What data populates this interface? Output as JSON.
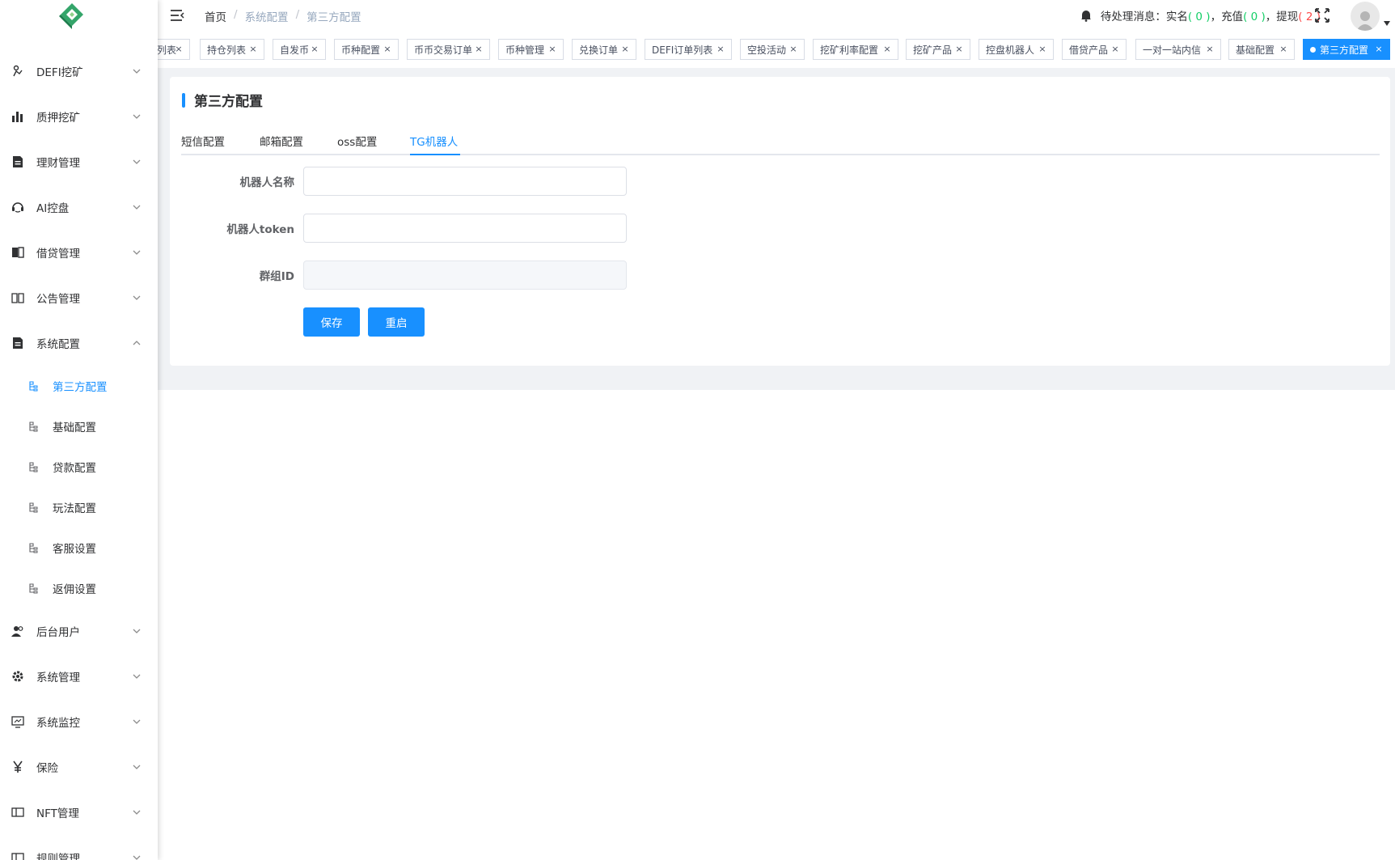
{
  "colors": {
    "primary": "#1890ff",
    "green": "#13ce66",
    "red": "#ff4949",
    "sidebar_bg": "#ffffff"
  },
  "sidebar": {
    "logo": "logo-icon",
    "menu": [
      {
        "label": "DEFI挖矿",
        "icon": "defi-icon"
      },
      {
        "label": "质押挖矿",
        "icon": "bar-chart-icon"
      },
      {
        "label": "理财管理",
        "icon": "document-icon"
      },
      {
        "label": "AI控盘",
        "icon": "robot-icon"
      },
      {
        "label": "借贷管理",
        "icon": "book-icon"
      },
      {
        "label": "公告管理",
        "icon": "open-book-icon"
      },
      {
        "label": "系统配置",
        "icon": "document-icon",
        "expanded": true
      },
      {
        "label": "后台用户",
        "icon": "users-icon"
      },
      {
        "label": "系统管理",
        "icon": "gear-icon"
      },
      {
        "label": "系统监控",
        "icon": "monitor-icon"
      },
      {
        "label": "保险",
        "icon": "yen-icon"
      },
      {
        "label": "NFT管理",
        "icon": "panel-icon"
      },
      {
        "label": "规则管理",
        "icon": "panel-icon"
      }
    ],
    "submenu": [
      {
        "label": "第三方配置",
        "active": true
      },
      {
        "label": "基础配置"
      },
      {
        "label": "贷款配置"
      },
      {
        "label": "玩法配置"
      },
      {
        "label": "客服设置"
      },
      {
        "label": "返佣设置"
      }
    ]
  },
  "navbar": {
    "breadcrumb": [
      "首页",
      "系统配置",
      "第三方配置"
    ],
    "breadcrumb_sep": "/",
    "notice": {
      "prefix": "待处理消息：",
      "items": [
        {
          "label": "实名",
          "count": "0",
          "color": "green"
        },
        {
          "label": "充值",
          "count": "0",
          "color": "green"
        },
        {
          "label": "提现",
          "count": "2",
          "color": "red"
        }
      ]
    }
  },
  "tags": [
    {
      "label": "列表"
    },
    {
      "label": "持仓列表"
    },
    {
      "label": "自发币"
    },
    {
      "label": "币种配置"
    },
    {
      "label": "币币交易订单"
    },
    {
      "label": "币种管理"
    },
    {
      "label": "兑换订单"
    },
    {
      "label": "DEFI订单列表"
    },
    {
      "label": "空投活动"
    },
    {
      "label": "挖矿利率配置"
    },
    {
      "label": "挖矿产品"
    },
    {
      "label": "控盘机器人"
    },
    {
      "label": "借贷产品"
    },
    {
      "label": "一对一站内信"
    },
    {
      "label": "基础配置"
    },
    {
      "label": "第三方配置",
      "active": true
    }
  ],
  "tag_close": "×",
  "page": {
    "title": "第三方配置",
    "tabs": [
      {
        "label": "短信配置"
      },
      {
        "label": "邮箱配置"
      },
      {
        "label": "oss配置"
      },
      {
        "label": "TG机器人",
        "active": true
      }
    ],
    "form": {
      "bot_name": {
        "label": "机器人名称",
        "value": "",
        "placeholder": ""
      },
      "bot_token": {
        "label": "机器人token",
        "value": "",
        "placeholder": ""
      },
      "group_id": {
        "label": "群组ID",
        "value": "",
        "placeholder": "",
        "disabled": true
      }
    },
    "buttons": {
      "save": "保存",
      "restart": "重启"
    }
  }
}
